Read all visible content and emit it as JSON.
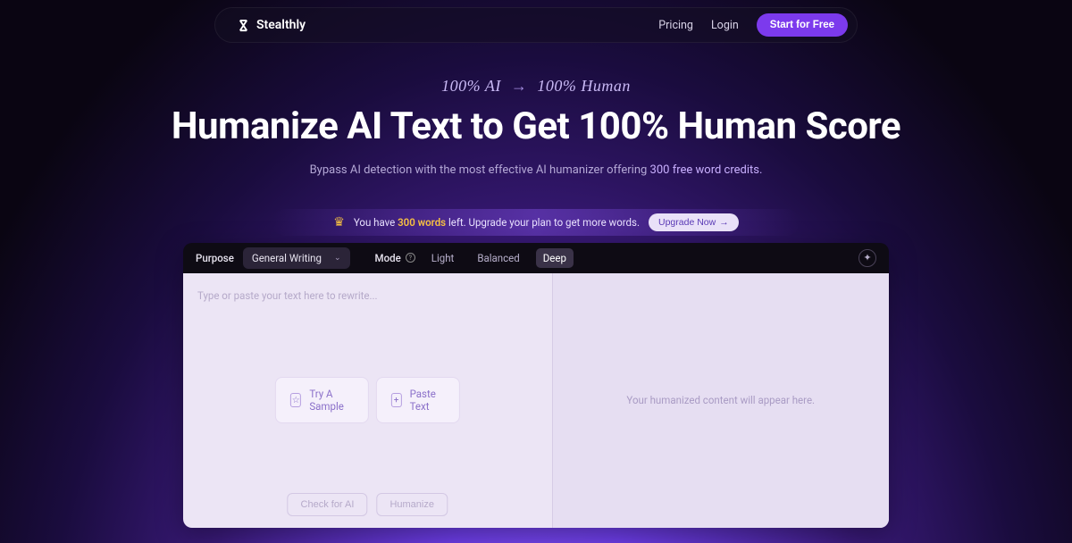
{
  "nav": {
    "brand": "Stealthly",
    "pricing": "Pricing",
    "login": "Login",
    "cta": "Start for Free"
  },
  "hero": {
    "tagline_left": "100% AI",
    "tagline_right": "100% Human",
    "headline": "Humanize AI Text to Get 100% Human Score",
    "subline_pre": "Bypass AI detection with the most effective AI humanizer offering ",
    "subline_credits": "300 free word credits."
  },
  "upgrade": {
    "text_pre": "You have ",
    "words": "300 words",
    "text_post": " left. Upgrade your plan to get more words.",
    "btn": "Upgrade Now"
  },
  "editor": {
    "purpose_label": "Purpose",
    "purpose_value": "General Writing",
    "mode_label": "Mode",
    "modes": {
      "light": "Light",
      "balanced": "Balanced",
      "deep": "Deep"
    },
    "input_placeholder": "Type or paste your text here to rewrite...",
    "try_sample": "Try A Sample",
    "paste_text": "Paste Text",
    "check_ai": "Check for AI",
    "humanize": "Humanize",
    "output_placeholder": "Your humanized content will appear here."
  }
}
